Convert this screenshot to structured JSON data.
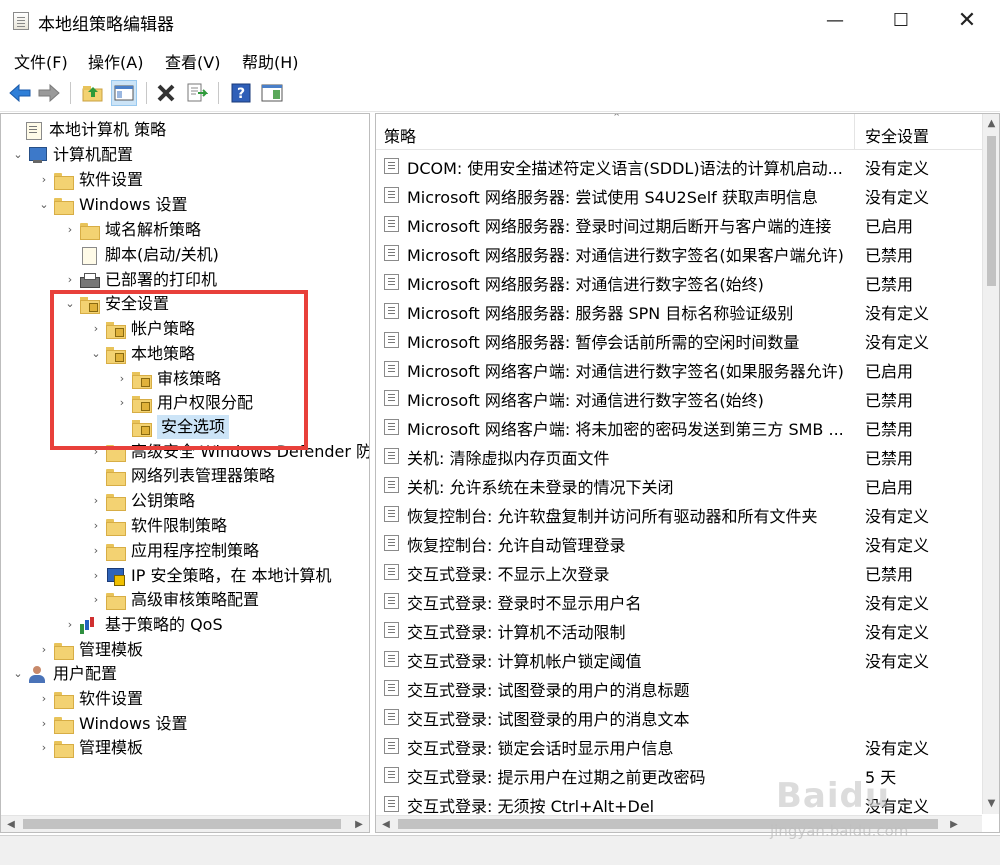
{
  "window": {
    "title": "本地组策略编辑器",
    "min": "—",
    "max": "☐",
    "close": "✕"
  },
  "menubar": [
    "文件(F)",
    "操作(A)",
    "查看(V)",
    "帮助(H)"
  ],
  "toolbar": {
    "icons": [
      "back-arrow-icon",
      "forward-arrow-icon",
      "up-folder-icon",
      "show-hide-console-tree-icon",
      "delete-icon",
      "export-list-icon",
      "help-icon",
      "properties-pane-icon"
    ]
  },
  "tree": {
    "items": [
      {
        "label": "本地计算机 策略",
        "icon": "scroll"
      },
      {
        "label": "计算机配置",
        "icon": "computer"
      },
      {
        "label": "软件设置",
        "icon": "folder"
      },
      {
        "label": "Windows 设置",
        "icon": "folder"
      },
      {
        "label": "域名解析策略",
        "icon": "folder"
      },
      {
        "label": "脚本(启动/关机)",
        "icon": "doc"
      },
      {
        "label": "已部署的打印机",
        "icon": "printer"
      },
      {
        "label": "安全设置",
        "icon": "lockfolder"
      },
      {
        "label": "帐户策略",
        "icon": "lockfolder"
      },
      {
        "label": "本地策略",
        "icon": "lockfolder"
      },
      {
        "label": "审核策略",
        "icon": "lockfolder"
      },
      {
        "label": "用户权限分配",
        "icon": "lockfolder"
      },
      {
        "label": "安全选项",
        "icon": "lockfolder"
      },
      {
        "label": "高级安全 Windows Defender 防",
        "icon": "folder"
      },
      {
        "label": "网络列表管理器策略",
        "icon": "folder"
      },
      {
        "label": "公钥策略",
        "icon": "folder"
      },
      {
        "label": "软件限制策略",
        "icon": "folder"
      },
      {
        "label": "应用程序控制策略",
        "icon": "folder"
      },
      {
        "label": "IP 安全策略，在 本地计算机",
        "icon": "ipsec"
      },
      {
        "label": "高级审核策略配置",
        "icon": "folder"
      },
      {
        "label": "基于策略的 QoS",
        "icon": "chart"
      },
      {
        "label": "管理模板",
        "icon": "folder"
      },
      {
        "label": "用户配置",
        "icon": "user"
      },
      {
        "label": "软件设置",
        "icon": "folder"
      },
      {
        "label": "Windows 设置",
        "icon": "folder"
      },
      {
        "label": "管理模板",
        "icon": "folder"
      }
    ]
  },
  "list": {
    "columns": {
      "policy": "策略",
      "setting": "安全设置"
    },
    "rows": [
      {
        "policy": "DCOM: 使用安全描述符定义语言(SDDL)语法的计算机启动...",
        "setting": "没有定义"
      },
      {
        "policy": "Microsoft 网络服务器: 尝试使用 S4U2Self 获取声明信息",
        "setting": "没有定义"
      },
      {
        "policy": "Microsoft 网络服务器: 登录时间过期后断开与客户端的连接",
        "setting": "已启用"
      },
      {
        "policy": "Microsoft 网络服务器: 对通信进行数字签名(如果客户端允许)",
        "setting": "已禁用"
      },
      {
        "policy": "Microsoft 网络服务器: 对通信进行数字签名(始终)",
        "setting": "已禁用"
      },
      {
        "policy": "Microsoft 网络服务器: 服务器 SPN 目标名称验证级别",
        "setting": "没有定义"
      },
      {
        "policy": "Microsoft 网络服务器: 暂停会话前所需的空闲时间数量",
        "setting": "没有定义"
      },
      {
        "policy": "Microsoft 网络客户端: 对通信进行数字签名(如果服务器允许)",
        "setting": "已启用"
      },
      {
        "policy": "Microsoft 网络客户端: 对通信进行数字签名(始终)",
        "setting": "已禁用"
      },
      {
        "policy": "Microsoft 网络客户端: 将未加密的密码发送到第三方 SMB ...",
        "setting": "已禁用"
      },
      {
        "policy": "关机: 清除虚拟内存页面文件",
        "setting": "已禁用"
      },
      {
        "policy": "关机: 允许系统在未登录的情况下关闭",
        "setting": "已启用"
      },
      {
        "policy": "恢复控制台: 允许软盘复制并访问所有驱动器和所有文件夹",
        "setting": "没有定义"
      },
      {
        "policy": "恢复控制台: 允许自动管理登录",
        "setting": "没有定义"
      },
      {
        "policy": "交互式登录: 不显示上次登录",
        "setting": "已禁用"
      },
      {
        "policy": "交互式登录: 登录时不显示用户名",
        "setting": "没有定义"
      },
      {
        "policy": "交互式登录: 计算机不活动限制",
        "setting": "没有定义"
      },
      {
        "policy": "交互式登录: 计算机帐户锁定阈值",
        "setting": "没有定义"
      },
      {
        "policy": "交互式登录: 试图登录的用户的消息标题",
        "setting": ""
      },
      {
        "policy": "交互式登录: 试图登录的用户的消息文本",
        "setting": ""
      },
      {
        "policy": "交互式登录: 锁定会话时显示用户信息",
        "setting": "没有定义"
      },
      {
        "policy": "交互式登录: 提示用户在过期之前更改密码",
        "setting": "5 天"
      },
      {
        "policy": "交互式登录: 无须按 Ctrl+Alt+Del",
        "setting": "没有定义"
      }
    ]
  },
  "watermark": {
    "brand": "Baidu",
    "url": "jingyan.baidu.com"
  },
  "colors": {
    "highlight_box": "#e8403a",
    "selection": "#cce4f7"
  }
}
